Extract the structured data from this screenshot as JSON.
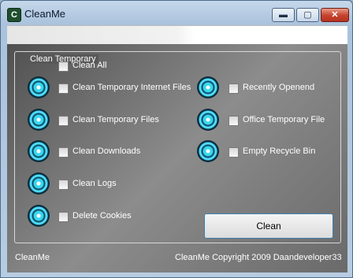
{
  "window": {
    "title": "CleanMe",
    "app_icon_glyph": "C",
    "controls": {
      "minimize": "▬",
      "maximize": "▢",
      "close": "✕"
    }
  },
  "group": {
    "title": "Clean Temporary"
  },
  "options": {
    "clean_all": "Clean All",
    "clean_temp_internet": "Clean Temporary Internet Files",
    "clean_temp_files": "Clean Temporary Files",
    "clean_downloads": "Clean Downloads",
    "clean_logs": "Clean Logs",
    "delete_cookies": "Delete Cookies",
    "recently_opened": "Recently Openend",
    "office_temp_file": "Office Temporary File",
    "empty_recycle_bin": "Empty Recycle Bin"
  },
  "actions": {
    "clean_button": "Clean"
  },
  "footer": {
    "left": "CleanMe",
    "right": "CleanMe Copyright 2009 Daandeveloper33"
  },
  "colors": {
    "accent_cyan": "#38d6f0",
    "title_bar": "#aac2dc",
    "close_red": "#c4412c",
    "panel_gray": "#6a6a6a"
  },
  "icons": [
    "app-c-icon",
    "status-indicator-icon",
    "minimize-icon",
    "maximize-icon",
    "close-icon"
  ]
}
